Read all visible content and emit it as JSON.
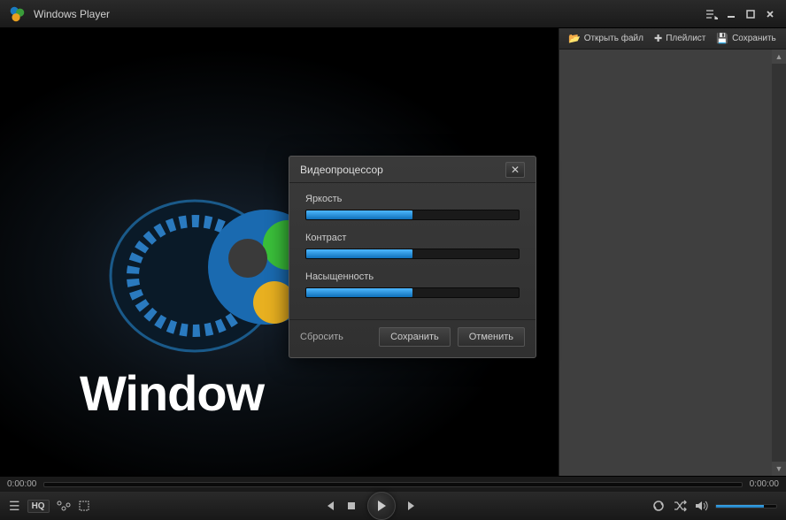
{
  "app": {
    "title": "Windows Player"
  },
  "sidebar": {
    "open_file": "Открыть файл",
    "playlist": "Плейлист",
    "save": "Сохранить"
  },
  "seekbar": {
    "current": "0:00:00",
    "total": "0:00:00"
  },
  "controls": {
    "hq_label": "HQ"
  },
  "dialog": {
    "title": "Видеопроцессор",
    "sliders": [
      {
        "label": "Яркость",
        "value": 50
      },
      {
        "label": "Контраст",
        "value": 50
      },
      {
        "label": "Насыщенность",
        "value": 50
      }
    ],
    "reset": "Сбросить",
    "save": "Сохранить",
    "cancel": "Отменить"
  },
  "brand": {
    "text": "Window"
  }
}
